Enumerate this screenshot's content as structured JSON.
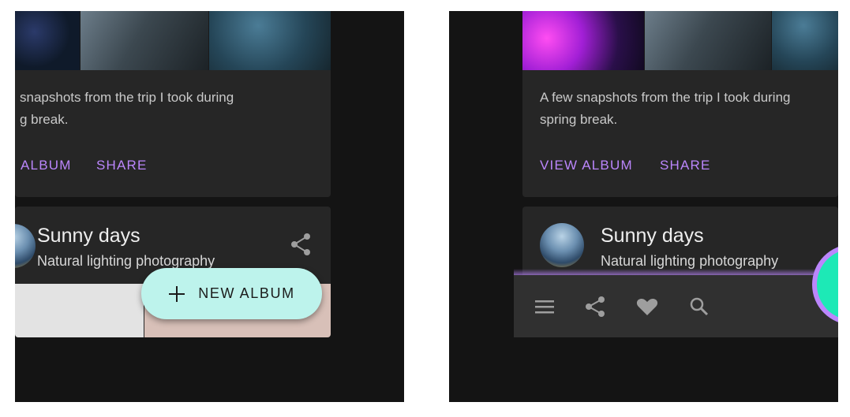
{
  "left_panel": {
    "album_card": {
      "description_line1": "snapshots from the trip I took during",
      "description_line2": "g break.",
      "view_album_label": "ALBUM",
      "share_label": "SHARE"
    },
    "sunny_card": {
      "title": "Sunny days",
      "subtitle": "Natural lighting photography",
      "share_icon": "share-icon"
    },
    "fab": {
      "label": "NEW ALBUM",
      "icon": "plus-icon"
    }
  },
  "right_panel": {
    "album_card": {
      "description_line1": "A few snapshots from the trip I took during",
      "description_line2": "spring break.",
      "view_album_label": "VIEW ALBUM",
      "share_label": "SHARE"
    },
    "sunny_card": {
      "title": "Sunny days",
      "subtitle": "Natural lighting photography",
      "avatar": "avatar"
    },
    "bottom_bar": {
      "icons": [
        "menu-icon",
        "share-icon",
        "heart-icon",
        "search-icon"
      ]
    }
  },
  "colors": {
    "accent": "#bb86fc",
    "fab_extended": "#bdf3ec",
    "fab_round": "#1de9b6",
    "surface": "#262626",
    "background": "#141414"
  }
}
